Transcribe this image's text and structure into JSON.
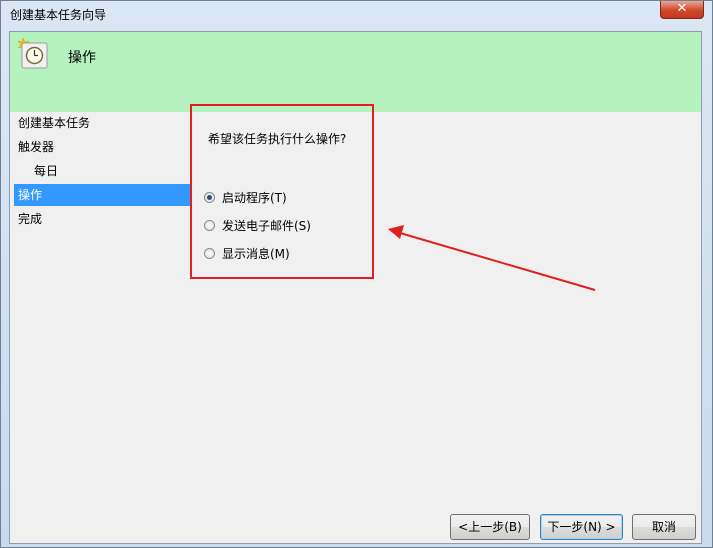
{
  "window": {
    "title": "创建基本任务向导",
    "close_glyph": "✕"
  },
  "header": {
    "title": "操作",
    "icon": "clock-icon"
  },
  "nav": {
    "items": [
      {
        "label": "创建基本任务"
      },
      {
        "label": "触发器"
      },
      {
        "label": "每日"
      },
      {
        "label": "操作"
      },
      {
        "label": "完成"
      }
    ]
  },
  "content": {
    "question": "希望该任务执行什么操作?",
    "options": [
      {
        "label": "启动程序(T)",
        "checked": true
      },
      {
        "label": "发送电子邮件(S)",
        "checked": false
      },
      {
        "label": "显示消息(M)",
        "checked": false
      }
    ]
  },
  "buttons": {
    "back": "<上一步(B)",
    "next": "下一步(N) >",
    "cancel": "取消"
  },
  "annotation": {
    "color": "#e02020"
  }
}
